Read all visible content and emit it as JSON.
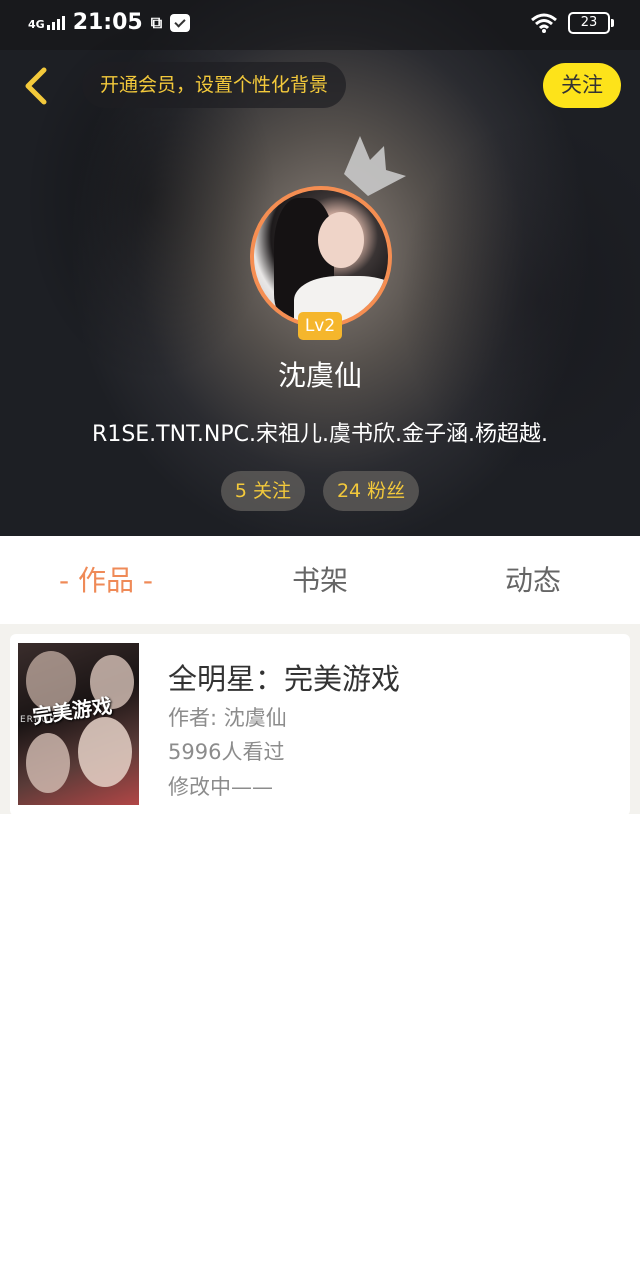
{
  "status_bar": {
    "network": "4G",
    "time": "21:05",
    "battery": "23"
  },
  "header": {
    "banner_text": "开通会员，设置个性化背景",
    "follow_label": "关注",
    "level": "Lv2",
    "username": "沈虞仙",
    "bio": "R1SE.TNT.NPC.宋祖儿.虞书欣.金子涵.杨超越.",
    "following": "5 关注",
    "followers": "24 粉丝"
  },
  "tabs": [
    {
      "label": "- 作品 -",
      "active": true
    },
    {
      "label": "书架",
      "active": false
    },
    {
      "label": "动态",
      "active": false
    }
  ],
  "works": [
    {
      "cover_text": "完美游戏",
      "cover_subtext": "ERROR",
      "title": "全明星：完美游戏",
      "author": "作者: 沈虞仙",
      "views": "5996人看过",
      "status": "修改中——"
    }
  ],
  "colors": {
    "accent": "#ef8a57",
    "follow_button": "#fde31a",
    "banner_text": "#f3c93b",
    "level_badge": "#f5b62c"
  }
}
